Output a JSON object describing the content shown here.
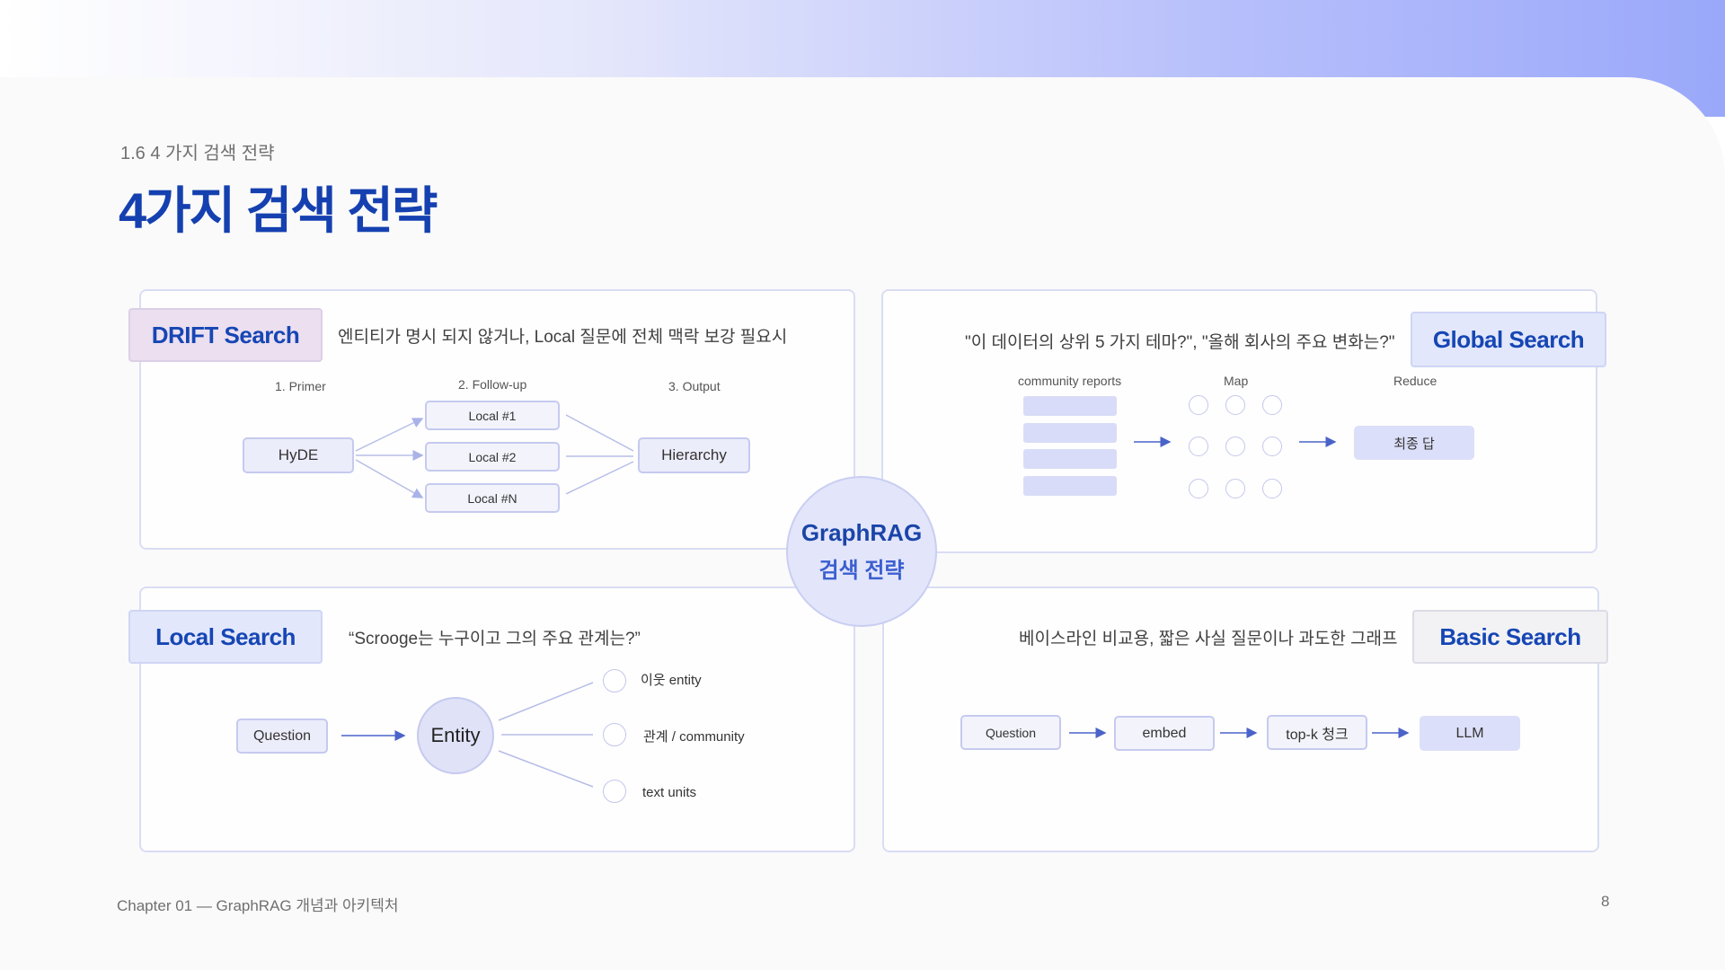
{
  "header": {
    "subtitle": "1.6 4 가지 검색 전략",
    "title": "4가지 검색 전략"
  },
  "center": {
    "line1": "GraphRAG",
    "line2": "검색 전략"
  },
  "drift": {
    "tag": "DRIFT Search",
    "desc": "엔티티가 명시 되지 않거나, Local 질문에 전체 맥락 보강 필요시",
    "step1": "1. Primer",
    "step2": "2. Follow-up",
    "step3": "3. Output",
    "hyde": "HyDE",
    "local1": "Local #1",
    "local2": "Local #2",
    "localN": "Local #N",
    "hierarchy": "Hierarchy"
  },
  "global": {
    "tag": "Global Search",
    "desc": "\"이 데이터의 상위 5 가지 테마?\", \"올해 회사의 주요 변화는?\"",
    "community_label": "community reports",
    "map_label": "Map",
    "reduce_label": "Reduce",
    "final": "최종 답"
  },
  "local": {
    "tag": "Local Search",
    "desc": "“Scrooge는 누구이고 그의 주요 관계는?”",
    "question": "Question",
    "entity": "Entity",
    "neighbor": "이웃 entity",
    "relation": "관계 / community",
    "text_units": "text units"
  },
  "basic": {
    "tag": "Basic Search",
    "desc": "베이스라인 비교용, 짧은 사실 질문이나 과도한 그래프",
    "question": "Question",
    "embed": "embed",
    "topk": "top-k 청크",
    "llm": "LLM"
  },
  "footer": {
    "chapter": "Chapter 01 — GraphRAG 개념과 아키텍처",
    "page": "8"
  },
  "colors": {
    "accent": "#1540b0",
    "tag_drift_bg": "#ebdff0",
    "tag_blue_bg": "#e3e7fb",
    "tag_basic_bg": "#f2f2f5",
    "node_bg": "#ecedfb"
  }
}
